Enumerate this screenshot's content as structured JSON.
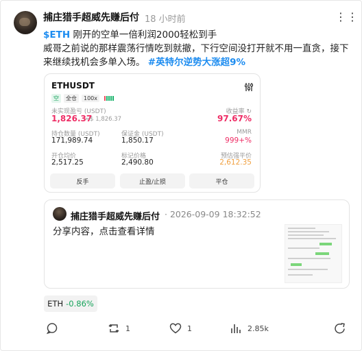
{
  "post": {
    "author": "捕庄猎手超威先赚后付",
    "separator": "·",
    "time": "18 小时前",
    "more": "⋮⋮⋮",
    "ticker": "$ETH",
    "text_after_ticker": " 刚开的空单一倍利润2000轻松到手",
    "text_line2": "威哥之前说的那样震荡行情吃到就撤，下行空间没打开就不用一直贪，接下来继续找机会多单入场。",
    "hashtag": "#英特尔逆势大涨超9%"
  },
  "position_card": {
    "symbol": "ETHUSDT",
    "side": "空",
    "margin_mode": "全仓",
    "leverage": "100x",
    "strength_bars": [
      "red",
      "green",
      "green",
      "green",
      "green"
    ],
    "unrealized_label": "未实现盈亏 (USDT)",
    "unrealized_value": "1,826.37",
    "unrealized_approx": "≈$ 1,826.37",
    "roi_label": "收益率",
    "roi_value": "97.67%",
    "size_label": "持仓数量 (USDT)",
    "size_value": "171,989.74",
    "margin_label": "保证金 (USDT)",
    "margin_value": "1,850.17",
    "mmr_label": "MMR",
    "mmr_value": "999+%",
    "entry_label": "开仓均价",
    "entry_value": "2,517.25",
    "mark_label": "标记价格",
    "mark_value": "2,490.80",
    "liq_label": "预估强平价",
    "liq_value": "2,612.35",
    "buttons": [
      "反手",
      "止盈/止损",
      "平仓"
    ]
  },
  "quote": {
    "author": "捕庄猎手超威先赚后付",
    "date": "· 2026-09-09 18:32:52",
    "text": "分享内容，点击查看详情"
  },
  "coin_pill": {
    "symbol": "ETH",
    "change": "-0.86%"
  },
  "actions": {
    "reposts": "1",
    "likes": "1",
    "views": "2.85k"
  }
}
